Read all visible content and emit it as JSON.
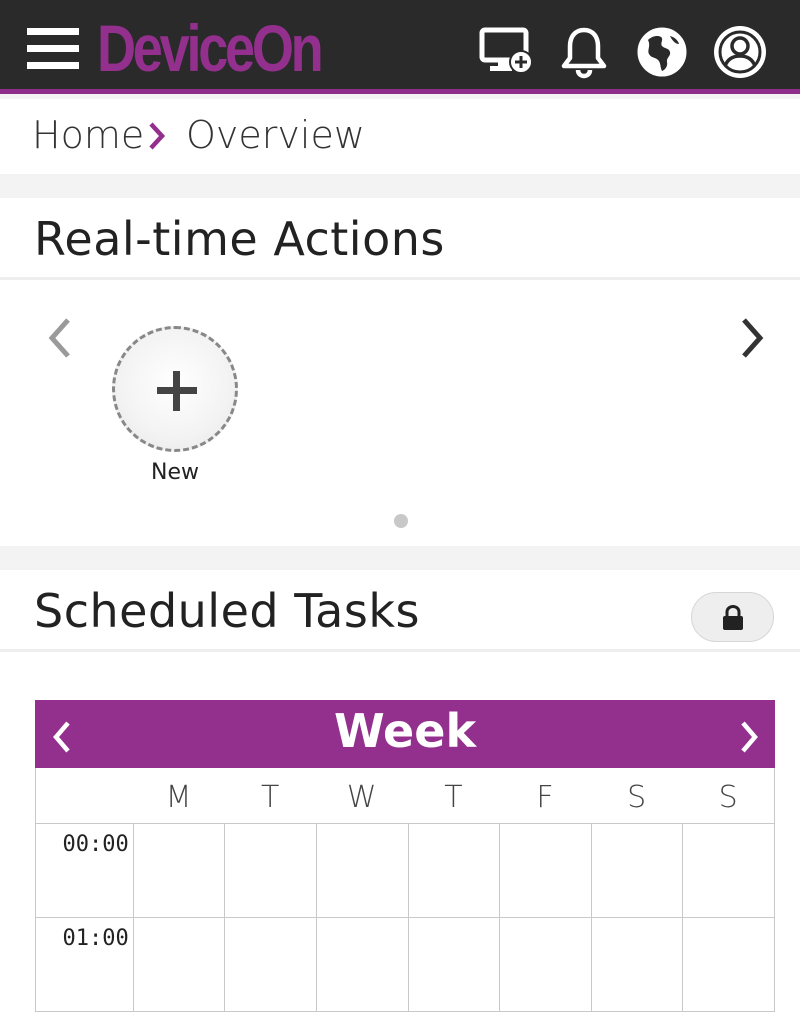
{
  "app": {
    "brand": "DeviceOn",
    "accent_color": "#93308d",
    "header_bg": "#2a2a2a",
    "icons": [
      "menu-icon",
      "add-device-icon",
      "bell-icon",
      "globe-icon",
      "user-icon"
    ]
  },
  "breadcrumb": {
    "home": "Home",
    "separator_icon": "chevron-right-icon",
    "current": "Overview"
  },
  "realtime_actions": {
    "title": "Real-time Actions",
    "new_label": "New"
  },
  "scheduled_tasks": {
    "title": "Scheduled Tasks",
    "lock_icon": "lock-icon",
    "calendar": {
      "view": "Week",
      "days": [
        "M",
        "T",
        "W",
        "T",
        "F",
        "S",
        "S"
      ],
      "times": [
        "00:00",
        "01:00"
      ]
    }
  }
}
